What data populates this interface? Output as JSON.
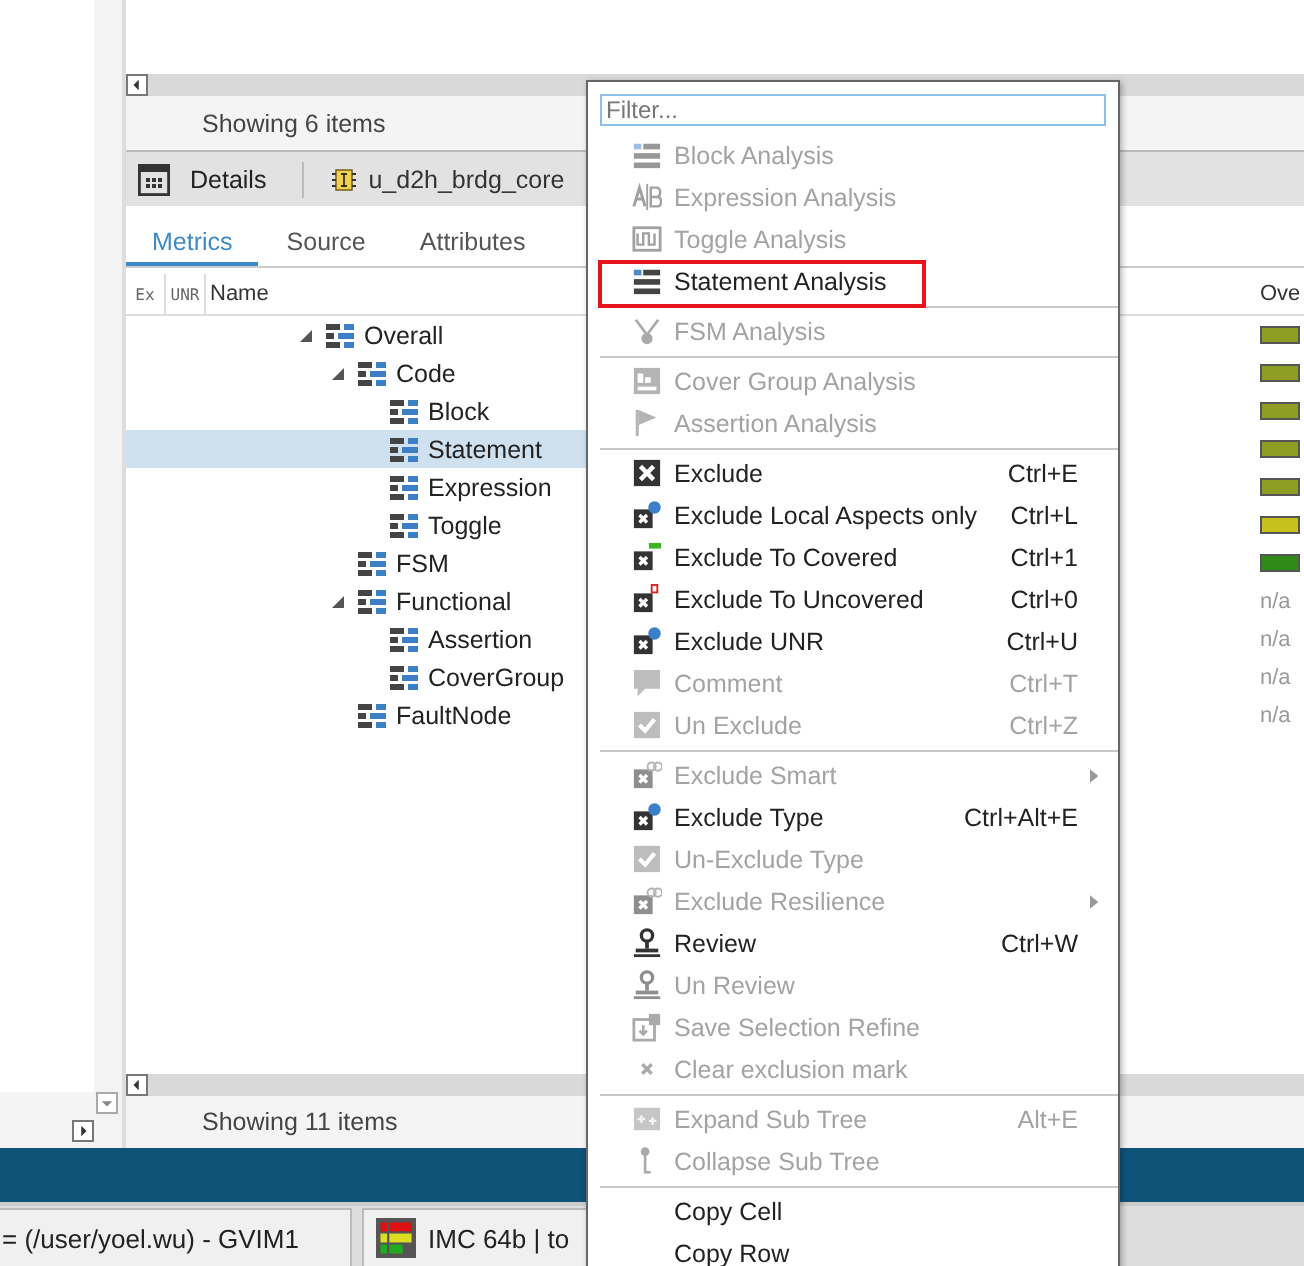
{
  "top_pane": {
    "status": "Showing 6 items"
  },
  "details": {
    "title": "Details",
    "instance": "u_d2h_brdg_core"
  },
  "tabs": [
    {
      "label": "Metrics",
      "selected": true
    },
    {
      "label": "Source",
      "selected": false
    },
    {
      "label": "Attributes",
      "selected": false
    }
  ],
  "columns": [
    "Ex",
    "UNR",
    "Name",
    "Ove"
  ],
  "tree": [
    {
      "name": "Overall",
      "expanded": true,
      "selected": false,
      "overall": {
        "kind": "bar",
        "color": "#8e9d24"
      },
      "children": [
        {
          "name": "Code",
          "expanded": true,
          "selected": false,
          "overall": {
            "kind": "bar",
            "color": "#8e9d24"
          },
          "children": [
            {
              "name": "Block",
              "selected": false,
              "overall": {
                "kind": "bar",
                "color": "#8e9d24"
              }
            },
            {
              "name": "Statement",
              "selected": true,
              "overall": {
                "kind": "bar",
                "color": "#8e9d24"
              }
            },
            {
              "name": "Expression",
              "selected": false,
              "overall": {
                "kind": "bar",
                "color": "#8e9d24"
              }
            },
            {
              "name": "Toggle",
              "selected": false,
              "overall": {
                "kind": "bar",
                "color": "#c8c01c"
              }
            }
          ]
        },
        {
          "name": "FSM",
          "selected": false,
          "overall": {
            "kind": "bar",
            "color": "#2f8a16"
          }
        },
        {
          "name": "Functional",
          "expanded": true,
          "selected": false,
          "overall": {
            "kind": "text",
            "text": "n/a"
          },
          "children": [
            {
              "name": "Assertion",
              "selected": false,
              "overall": {
                "kind": "text",
                "text": "n/a"
              }
            },
            {
              "name": "CoverGroup",
              "selected": false,
              "overall": {
                "kind": "text",
                "text": "n/a"
              }
            }
          ]
        },
        {
          "name": "FaultNode",
          "selected": false,
          "overall": {
            "kind": "text",
            "text": "n/a"
          }
        }
      ]
    }
  ],
  "bottom_status": "Showing 11 items",
  "taskbar": [
    {
      "label": "= (/user/yoel.wu) - GVIM1"
    },
    {
      "label": "IMC 64b | to"
    }
  ],
  "context_menu": {
    "filter_placeholder": "Filter...",
    "groups": [
      [
        {
          "label": "Block Analysis",
          "disabled": true,
          "highlighted": false
        },
        {
          "label": "Expression Analysis",
          "disabled": true,
          "highlighted": false
        },
        {
          "label": "Toggle Analysis",
          "disabled": true,
          "highlighted": false
        },
        {
          "label": "Statement Analysis",
          "disabled": false,
          "highlighted": true
        }
      ],
      [
        {
          "label": "FSM Analysis",
          "disabled": true,
          "highlighted": false
        }
      ],
      [
        {
          "label": "Cover Group Analysis",
          "disabled": true,
          "highlighted": false
        },
        {
          "label": "Assertion Analysis",
          "disabled": true,
          "highlighted": false
        }
      ],
      [
        {
          "label": "Exclude",
          "shortcut": "Ctrl+E",
          "disabled": false,
          "highlighted": false
        },
        {
          "label": "Exclude Local Aspects only",
          "shortcut": "Ctrl+L",
          "disabled": false,
          "highlighted": false
        },
        {
          "label": "Exclude To Covered",
          "shortcut": "Ctrl+1",
          "disabled": false,
          "highlighted": false
        },
        {
          "label": "Exclude To Uncovered",
          "shortcut": "Ctrl+0",
          "disabled": false,
          "highlighted": false
        },
        {
          "label": "Exclude UNR",
          "shortcut": "Ctrl+U",
          "disabled": false,
          "highlighted": false
        },
        {
          "label": "Comment",
          "shortcut": "Ctrl+T",
          "disabled": true,
          "highlighted": false
        },
        {
          "label": "Un Exclude",
          "shortcut": "Ctrl+Z",
          "disabled": true,
          "highlighted": false
        }
      ],
      [
        {
          "label": "Exclude Smart",
          "disabled": true,
          "submenu": true,
          "highlighted": false
        },
        {
          "label": "Exclude Type",
          "shortcut": "Ctrl+Alt+E",
          "disabled": false,
          "highlighted": false
        },
        {
          "label": "Un-Exclude Type",
          "disabled": true,
          "highlighted": false
        },
        {
          "label": "Exclude Resilience",
          "disabled": true,
          "submenu": true,
          "highlighted": false
        },
        {
          "label": "Review",
          "shortcut": "Ctrl+W",
          "disabled": false,
          "highlighted": false
        },
        {
          "label": "Un Review",
          "disabled": true,
          "highlighted": false
        },
        {
          "label": "Save Selection Refine",
          "disabled": true,
          "highlighted": false
        },
        {
          "label": "Clear exclusion mark",
          "disabled": true,
          "highlighted": false
        }
      ],
      [
        {
          "label": "Expand Sub Tree",
          "shortcut": "Alt+E",
          "disabled": true,
          "highlighted": false
        },
        {
          "label": "Collapse Sub Tree",
          "disabled": true,
          "highlighted": false
        }
      ],
      [
        {
          "label": "Copy Cell",
          "disabled": false,
          "highlighted": false
        },
        {
          "label": "Copy Row",
          "disabled": false,
          "highlighted": false
        }
      ]
    ]
  }
}
